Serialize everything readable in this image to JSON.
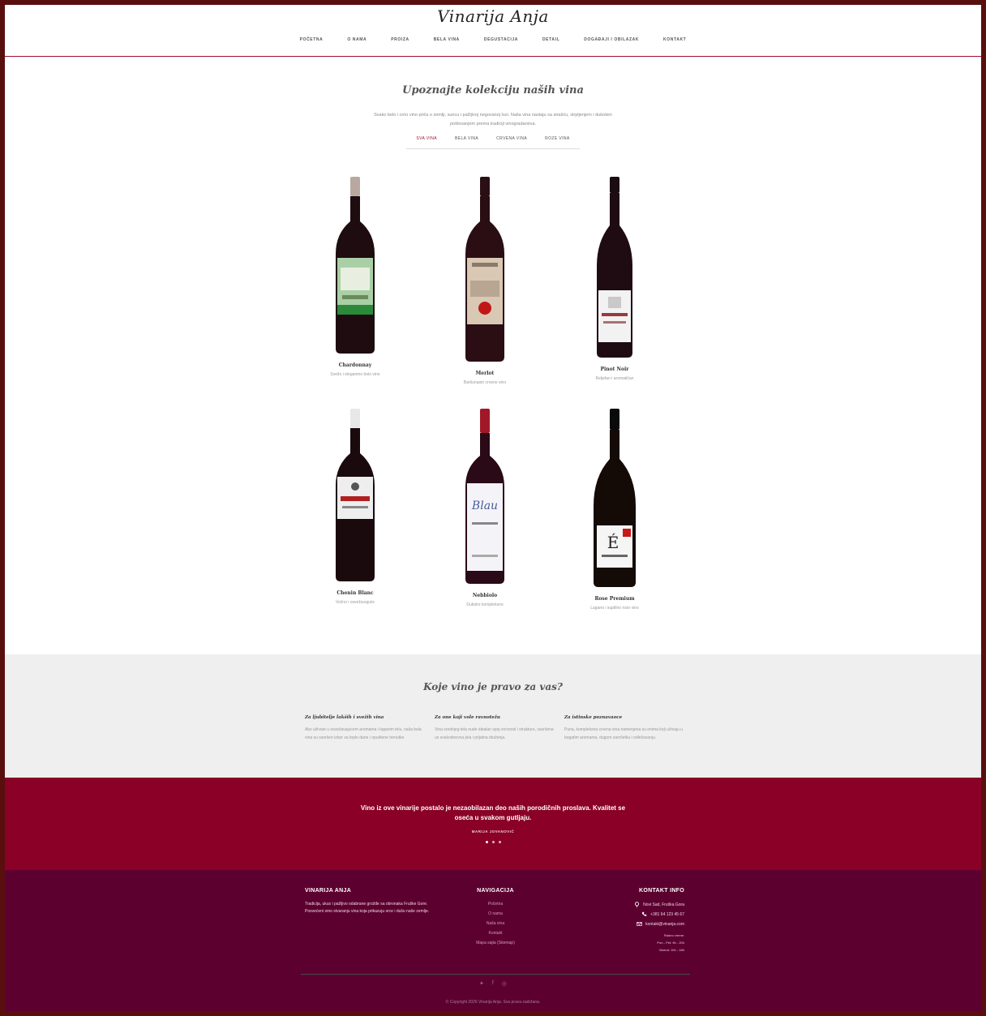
{
  "header": {
    "logo": "Vinarija Anja",
    "nav": [
      "POČETNA",
      "O NAMA",
      "PROIZA",
      "BELA VINA",
      "DEGUSTACIJA",
      "DETAIL",
      "DOGAĐAJI I OBILAZAK",
      "KONTAKT"
    ]
  },
  "collection": {
    "title": "Upoznajte kolekciju naših vina",
    "intro": "Svako belo i crno vino priča o zemlji, suncu i pažljivoj negovanoj lozi. Naša vina nastaju sa strašću, strpljenjem i dubokim poštovanjem prema tradiciji vinogradarstva.",
    "tabs": [
      "SVA VINA",
      "BELA VINA",
      "CRVENA VINA",
      "ROZE VINA"
    ],
    "wines": [
      {
        "name": "Chardonnay",
        "desc": "Svežo i elegantno belo vino",
        "label_color": "#a9cfa6"
      },
      {
        "name": "Merlot",
        "desc": "Baršunasto crveno vino",
        "label_color": "#d9c8b4"
      },
      {
        "name": "Pinot Noir",
        "desc": "Reljefan i aromatičan",
        "label_color": "#f2f2f2"
      },
      {
        "name": "Chenin Blanc",
        "desc": "Vočno i osvežavajuće",
        "label_color": "#eeeeee"
      },
      {
        "name": "Nebbiolo",
        "desc": "Duboko kompleksno",
        "label_color": "#f4f4f8"
      },
      {
        "name": "Rose Premium",
        "desc": "Lagano i suptilno roze vino",
        "label_color": "#f5f5f5"
      }
    ]
  },
  "which": {
    "title": "Koje vino je pravo za vas?",
    "columns": [
      {
        "heading": "Za ljubitelje lakših i svežih vina",
        "text": "Ako uživate u osvežavajućem aromama i laganim telu, naša bela vina su savršen izbor za tople dane i opuštene trenutke."
      },
      {
        "heading": "Za one koji vole ravnotežu",
        "text": "Vina srednjeg tela nude idealan spoj voćnosti i strukture, savršena uz svakodnevna jela i prijatna druženja."
      },
      {
        "heading": "Za istinske poznavaoce",
        "text": "Puna, kompleksna crvena vina namenjena su onima koji uživaju u bogatim aromama, dugom završetku i odležavanju."
      }
    ]
  },
  "quote": {
    "text": "Vino iz ove vinarije postalo je nezaobilazan deo naših porodičnih proslava. Kvalitet se oseća u svakom gutljaju.",
    "author": "MARIJA JOVANOVIĆ"
  },
  "footer": {
    "about_title": "VINARIJA ANJA",
    "about_text": "Tradicija, ukus i pažljivo odabrane grožđe sa obronaka Fruške Gore. Posvećeni smo stvaranju vina koja prikazuju srce i dušu naše zemlje.",
    "nav_title": "NAVIGACIJA",
    "nav_links": [
      "Početna",
      "O nama",
      "Naša vina",
      "Kontakt",
      "Mapa sajta (Sitemap)"
    ],
    "contact_title": "KONTAKT INFO",
    "address": "Novi Sad, Fruška Gora",
    "phone": "+381 64 123 45 67",
    "email": "kontakt@vinarija.com",
    "hours_title": "Radno vreme:",
    "hours": [
      "Pon - Pet: 9h - 20h",
      "Vikend: 10h - 18h"
    ],
    "copyright": "© Copyright 2026 Vinarija Anja. Sva prava zadržana."
  }
}
